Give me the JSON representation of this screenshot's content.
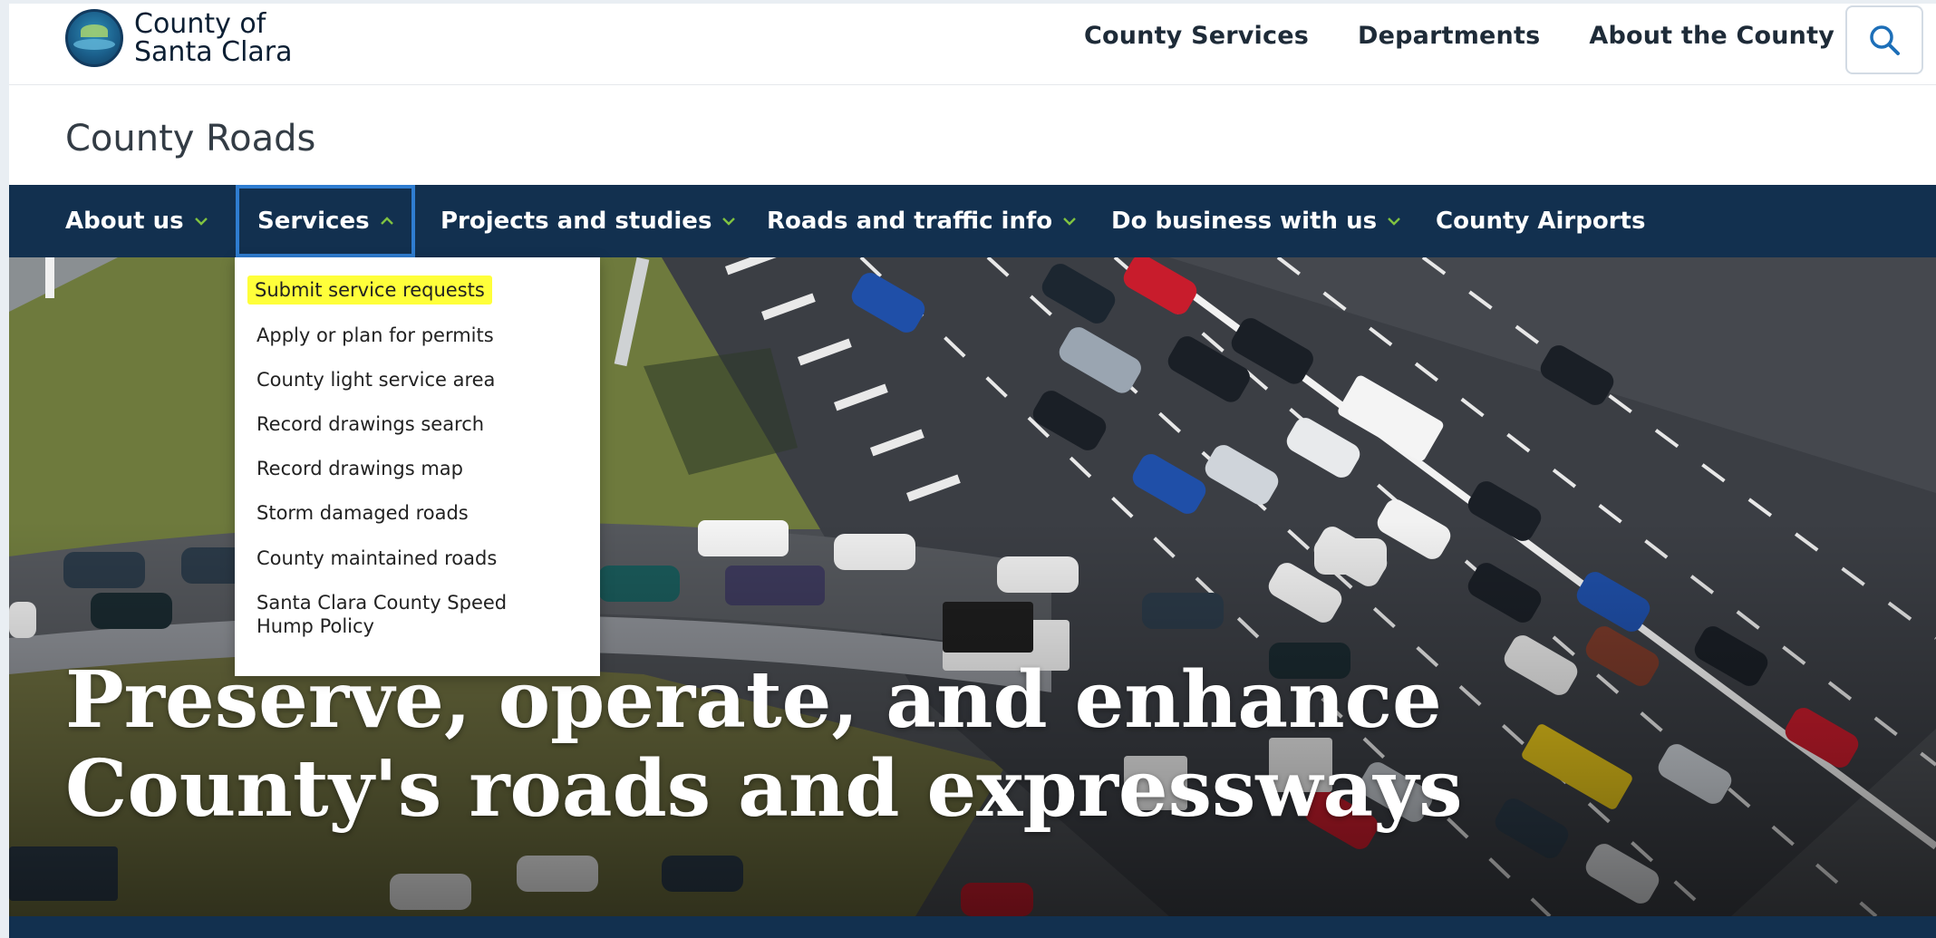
{
  "header": {
    "logo_line1": "County of",
    "logo_line2": "Santa Clara",
    "nav": [
      "County Services",
      "Departments",
      "About the County"
    ],
    "search_icon": "search-icon"
  },
  "section_title": "County Roads",
  "main_nav": [
    {
      "label": "About us",
      "has_chevron": true,
      "expanded": false
    },
    {
      "label": "Services",
      "has_chevron": true,
      "expanded": true
    },
    {
      "label": "Projects and studies",
      "has_chevron": true,
      "expanded": false
    },
    {
      "label": "Roads and traffic info",
      "has_chevron": true,
      "expanded": false
    },
    {
      "label": "Do business with us",
      "has_chevron": true,
      "expanded": false
    },
    {
      "label": "County Airports",
      "has_chevron": false,
      "expanded": false
    }
  ],
  "services_menu": [
    "Submit service requests",
    "Apply or plan for permits",
    "County light service area",
    "Record drawings search",
    "Record drawings map",
    "Storm damaged roads",
    "County maintained roads",
    "Santa Clara County Speed Hump Policy"
  ],
  "highlighted_item": "Submit service requests",
  "hero": {
    "headline": "Preserve, operate, and enhance County's roads and expressways"
  },
  "colors": {
    "nav_bg": "#12304f",
    "chevron": "#7fc241",
    "active_border": "#2f7dd1",
    "highlight": "#ffff3a"
  }
}
